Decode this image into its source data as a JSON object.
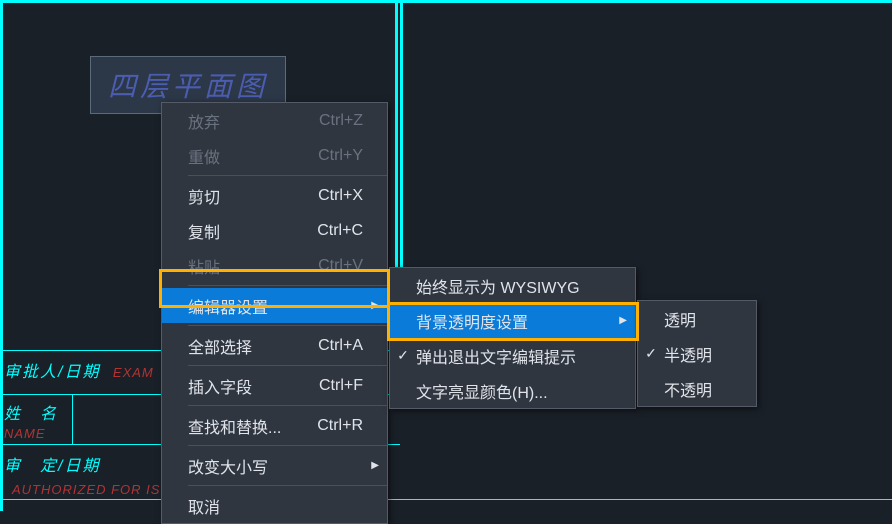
{
  "drawing": {
    "title_text": "四层平面图",
    "labels": {
      "approver_date": "审批人/日期",
      "approver_date_en": "EXAM",
      "name": "姓　名",
      "name_en": "NAME",
      "authorized_date": "审　定/日期",
      "authorized_en": "AUTHORIZED FOR ISSUE BY /DATE"
    }
  },
  "main_menu": [
    {
      "label": "放弃",
      "shortcut": "Ctrl+Z",
      "disabled": true
    },
    {
      "label": "重做",
      "shortcut": "Ctrl+Y",
      "disabled": true
    },
    {
      "sep": true
    },
    {
      "label": "剪切",
      "shortcut": "Ctrl+X"
    },
    {
      "label": "复制",
      "shortcut": "Ctrl+C"
    },
    {
      "label": "粘贴",
      "shortcut": "Ctrl+V",
      "disabled": true
    },
    {
      "sep": true
    },
    {
      "label": "编辑器设置",
      "submenu": true,
      "highlighted": true
    },
    {
      "sep": true
    },
    {
      "label": "全部选择",
      "shortcut": "Ctrl+A"
    },
    {
      "sep": true
    },
    {
      "label": "插入字段",
      "shortcut": "Ctrl+F"
    },
    {
      "sep": true
    },
    {
      "label": "查找和替换...",
      "shortcut": "Ctrl+R"
    },
    {
      "sep": true
    },
    {
      "label": "改变大小写",
      "submenu": true
    },
    {
      "sep": true
    },
    {
      "label": "取消"
    }
  ],
  "sub_menu": [
    {
      "label": "始终显示为 WYSIWYG"
    },
    {
      "label": "背景透明度设置",
      "submenu": true,
      "highlighted": true
    },
    {
      "label": "弹出退出文字编辑提示",
      "checked": true
    },
    {
      "label": "文字亮显颜色(H)..."
    }
  ],
  "sub_menu2": [
    {
      "label": "透明"
    },
    {
      "label": "半透明",
      "checked": true
    },
    {
      "label": "不透明"
    }
  ]
}
